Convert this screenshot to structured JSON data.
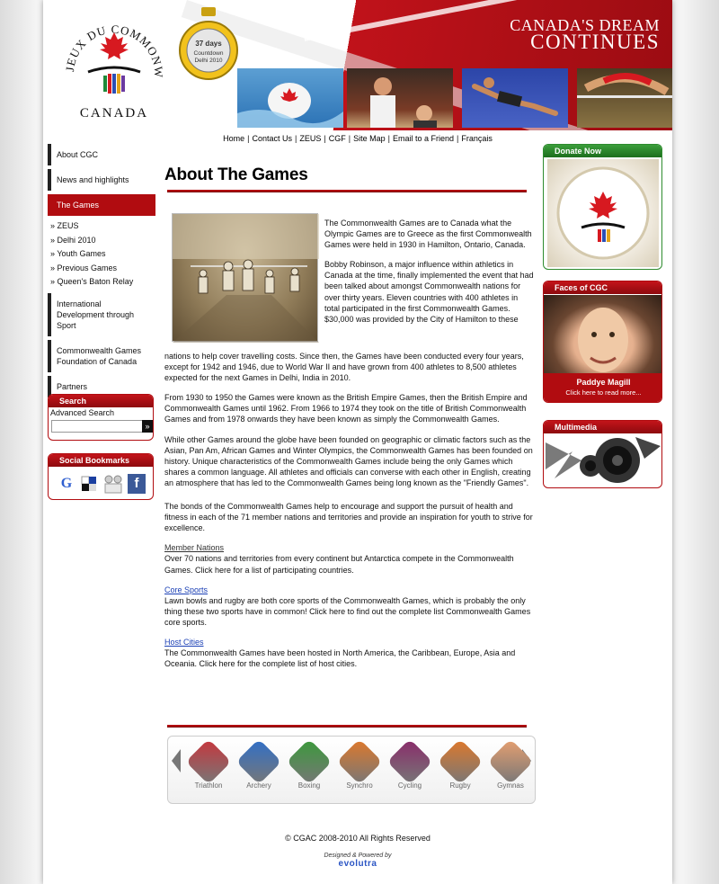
{
  "header": {
    "logo_text": "JEUX DU COMMONWEALTH GAMES CANADA",
    "slogan_line1": "CANADA'S DREAM",
    "slogan_line2": "CONTINUES",
    "countdown": {
      "days": "37 days",
      "label": "Countdown",
      "event": "Delhi 2010"
    }
  },
  "topnav": [
    "Home",
    "Contact Us",
    "ZEUS",
    "CGF",
    "Site Map",
    "Email to a Friend",
    "Français"
  ],
  "leftnav": {
    "items_before": [
      "About CGC",
      "News and highlights"
    ],
    "active": "The Games",
    "subitems": [
      "ZEUS",
      "Delhi 2010",
      "Youth Games",
      "Previous Games",
      "Queen's Baton Relay"
    ],
    "items_after": [
      "International Development through Sport",
      "Commonwealth Games Foundation of Canada",
      "Partners"
    ]
  },
  "search": {
    "title": "Search",
    "advanced": "Advanced Search",
    "go": "»"
  },
  "social": {
    "title": "Social Bookmarks",
    "icons": [
      "google-icon",
      "delicious-icon",
      "digg-icon",
      "facebook-icon"
    ]
  },
  "main": {
    "title": "About The Games",
    "intro_p1": "The Commonwealth Games are to Canada what the Olympic Games are to Greece as the first Commonwealth Games were held in 1930 in Hamilton, Ontario, Canada.",
    "intro_p2": "Bobby Robinson, a major influence within athletics in Canada at the time, finally implemented the event that had been talked about amongst Commonwealth nations for over thirty years. Eleven countries with 400 athletes in total participated in the first Commonwealth Games. $30,000 was provided by the City of Hamilton to these",
    "p3": "nations to help cover travelling costs. Since then, the Games have been conducted every four years, except for 1942 and 1946, due to World War II and have grown from 400 athletes to 8,500 athletes expected for the next Games in Delhi, India in 2010.",
    "p4": "From 1930 to 1950 the Games were known as the British Empire Games, then the British Empire and Commonwealth Games until 1962. From 1966 to 1974 they took on the title of British Commonwealth Games and from 1978 onwards they have been known as simply the Commonwealth Games.",
    "p5": "While other Games around the globe have been founded on geographic or climatic factors such as the Asian, Pan Am, African Games and Winter Olympics, the Commonwealth Games has been founded on history. Unique characteristics of the Commonwealth Games include being the only Games which shares a common language. All athletes and officials can converse with each other in English, creating an atmosphere that has led to the Commonwealth Games being long known as the \"Friendly Games\".",
    "p6": "The bonds of the Commonwealth Games help to encourage and support the pursuit of health and fitness in each of the 71 member nations and territories and provide an inspiration for youth to strive for excellence.",
    "member_head": "Member Nations",
    "member_text": "Over 70 nations and territories from every continent but Antarctica compete in the Commonwealth Games.  Click here for a list of participating countries.",
    "core_head": "Core Sports",
    "core_text": "Lawn bowls and rugby are both core sports of the Commonwealth Games, which is probably the only thing these two sports have in common!  Click here to find out the complete list Commonwealth Games core sports.",
    "host_head": "Host Cities",
    "host_text": "The Commonwealth Games have been hosted in North America, the Caribbean, Europe, Asia and Oceania. Click here for the complete list of host cities."
  },
  "sports": [
    {
      "label": "Triathlon",
      "color": "#c8353c"
    },
    {
      "label": "Archery",
      "color": "#2f6fc9"
    },
    {
      "label": "Boxing",
      "color": "#3a9a3a"
    },
    {
      "label": "Synchro",
      "color": "#e0782a"
    },
    {
      "label": "Cycling",
      "color": "#8a2a6a"
    },
    {
      "label": "Rugby",
      "color": "#e0782a"
    },
    {
      "label": "Gymnas",
      "color": "#e8a070"
    }
  ],
  "right": {
    "donate_title": "Donate Now",
    "faces_title": "Faces of CGC",
    "faces_name": "Paddye Magill",
    "faces_link": "Click here to read more...",
    "multimedia_title": "Multimedia"
  },
  "footer": {
    "copyright": "© CGAC 2008-2010 All Rights Reserved",
    "designed": "Designed & Powered by",
    "brand": "evolutra"
  },
  "colors": {
    "brand_red": "#b10c10",
    "donate_green": "#2e8b2e",
    "link_blue": "#1a3fb5"
  }
}
